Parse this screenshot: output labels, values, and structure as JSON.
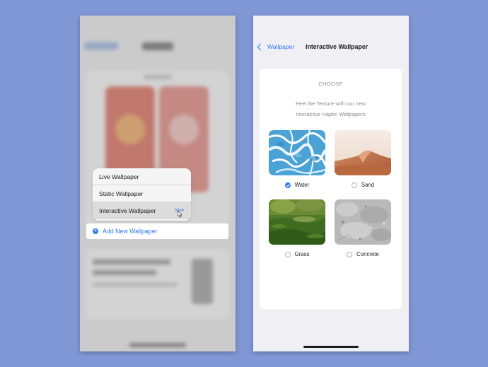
{
  "left_screen": {
    "menu": {
      "items": [
        {
          "label": "Live Wallpaper",
          "badge": ""
        },
        {
          "label": "Static Wallpaper",
          "badge": ""
        },
        {
          "label": "Interactive Wallpaper",
          "badge": "New"
        }
      ],
      "add_new_label": "Add New Wallpaper",
      "add_icon": "plus-circle-icon"
    }
  },
  "right_screen": {
    "nav": {
      "back_label": "Wallpaper",
      "back_icon": "chevron-left-icon",
      "title": "Interactive Wallpaper"
    },
    "section_header": "CHOOSE",
    "subtitle_line1": "Feel the Texture with our new",
    "subtitle_line2": "Interactive Haptic Wallpapers",
    "options": [
      {
        "label": "Water",
        "selected": true
      },
      {
        "label": "Sand",
        "selected": false
      },
      {
        "label": "Grass",
        "selected": false
      },
      {
        "label": "Concrete",
        "selected": false
      }
    ]
  },
  "colors": {
    "background": "#7f97d5",
    "accent": "#2f7af0",
    "secondary_text": "#8e8e93"
  }
}
